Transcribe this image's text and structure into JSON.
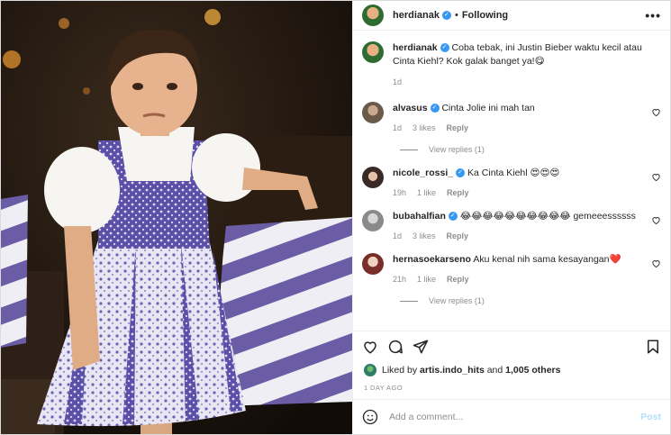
{
  "post": {
    "username": "herdianak",
    "following_label": "Following",
    "more_label": "•••",
    "caption": "Coba tebak, ini Justin Bieber waktu kecil atau Cinta Kiehl? Kok galak banget ya!😋",
    "caption_age": "1d"
  },
  "comments": [
    {
      "username": "alvasus",
      "verified": true,
      "text": "Cinta Jolie ini mah tan",
      "age": "1d",
      "likes": "3 likes",
      "reply": "Reply",
      "view_replies": "View replies (1)",
      "avatar_color": "#6b5a4a"
    },
    {
      "username": "nicole_rossi_",
      "verified": true,
      "text": "Ka Cinta Kiehl 😍😍😍",
      "age": "19h",
      "likes": "1 like",
      "reply": "Reply",
      "avatar_color": "#3a2a25"
    },
    {
      "username": "bubahalfian",
      "verified": true,
      "text": "😂😂😂😂😂😂😂😂😂😂 gemeeessssss",
      "age": "1d",
      "likes": "3 likes",
      "reply": "Reply",
      "avatar_color": "#8a8a8a"
    },
    {
      "username": "hernasoekarseno",
      "verified": false,
      "text": "Aku kenal nih sama kesayangan❤️",
      "age": "21h",
      "likes": "1 like",
      "reply": "Reply",
      "view_replies": "View replies (1)",
      "avatar_color": "#7a2e2a"
    }
  ],
  "likes": {
    "prefix": "Liked by",
    "user": "artis.indo_hits",
    "and": "and",
    "others": "1,005 others"
  },
  "date": "1 DAY AGO",
  "add_comment": {
    "placeholder": "Add a comment...",
    "post_label": "Post"
  },
  "icons": {
    "like": "heart-icon",
    "comment": "comment-icon",
    "share": "share-icon",
    "save": "bookmark-icon",
    "emoji": "emoji-icon"
  },
  "colors": {
    "verified": "#3897f0",
    "muted": "#8e8e8e",
    "post_disabled": "#b2dffc"
  }
}
